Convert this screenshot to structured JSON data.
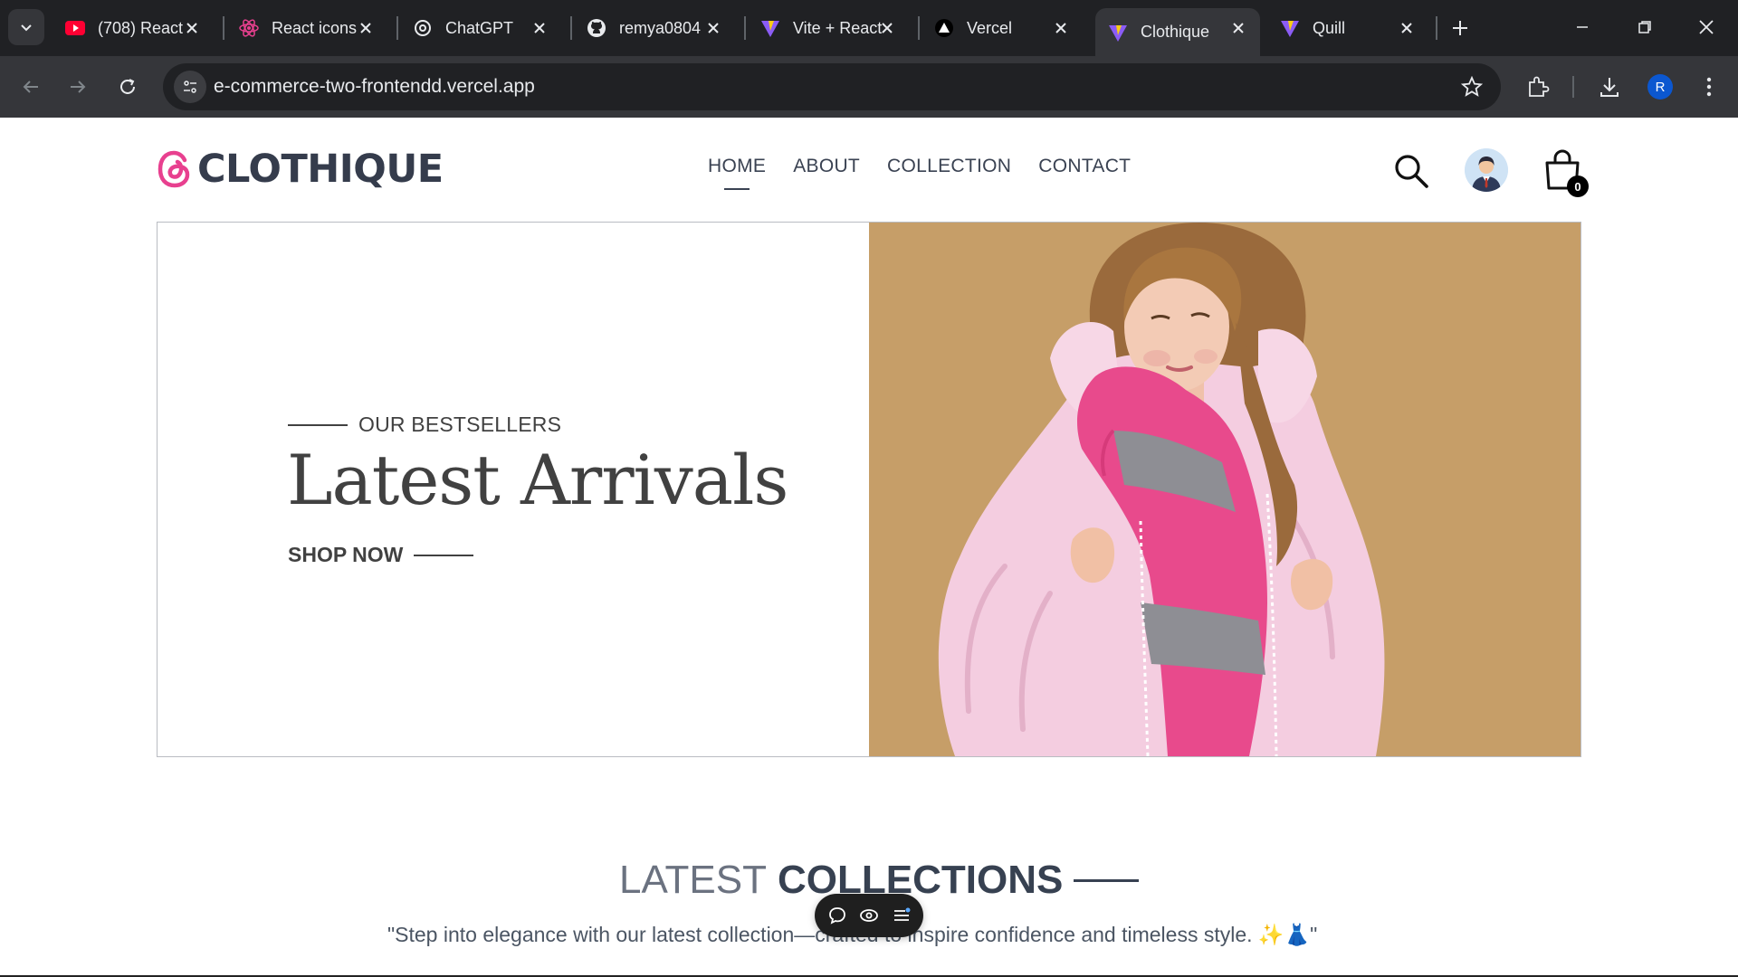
{
  "browser": {
    "tabs": [
      {
        "title": "(708) React",
        "favicon": "youtube-icon",
        "active": false
      },
      {
        "title": "React icons",
        "favicon": "react-icon",
        "active": false
      },
      {
        "title": "ChatGPT",
        "favicon": "chatgpt-icon",
        "active": false
      },
      {
        "title": "remya0804",
        "favicon": "github-icon",
        "active": false
      },
      {
        "title": "Vite + React",
        "favicon": "vite-icon",
        "active": false
      },
      {
        "title": "Vercel",
        "favicon": "vercel-icon",
        "active": false
      },
      {
        "title": "Clothique",
        "favicon": "vite-icon",
        "active": true
      },
      {
        "title": "Quill",
        "favicon": "vite-icon",
        "active": false
      }
    ],
    "url": "e-commerce-two-frontendd.vercel.app",
    "profile_initial": "R"
  },
  "site": {
    "logo_text": "CLOTHIQUE",
    "nav": [
      {
        "label": "HOME",
        "active": true
      },
      {
        "label": "ABOUT",
        "active": false
      },
      {
        "label": "COLLECTION",
        "active": false
      },
      {
        "label": "CONTACT",
        "active": false
      }
    ],
    "cart_count": "0"
  },
  "hero": {
    "eyebrow": "OUR BESTSELLERS",
    "headline": "Latest Arrivals",
    "cta": "SHOP NOW"
  },
  "collections": {
    "title_light": "LATEST",
    "title_bold": "COLLECTIONS",
    "tagline": "\"Step into elegance with our latest collection—crafted to inspire confidence and timeless style. ✨👗\""
  },
  "colors": {
    "accent_pink": "#e8408f",
    "hero_background": "#c69e68",
    "text_dark": "#353c4c"
  }
}
